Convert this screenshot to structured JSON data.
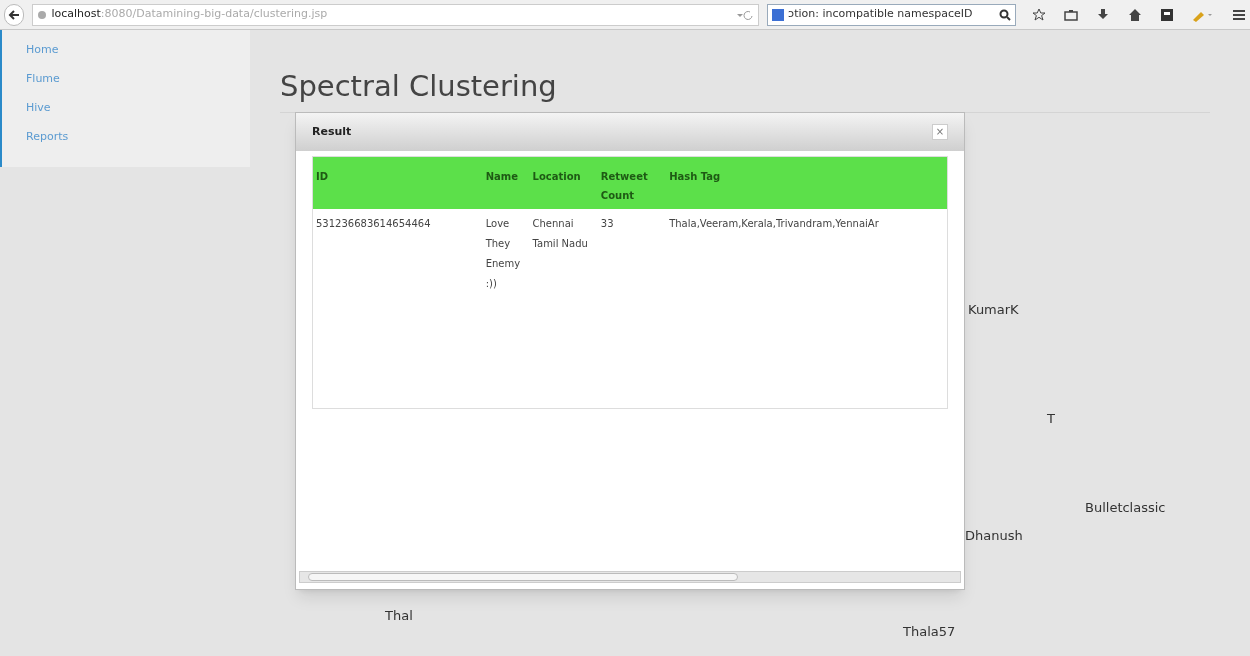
{
  "browser": {
    "url_host": "localhost",
    "url_path": ":8080/Datamining-big-data/clustering.jsp",
    "search_value": "ɔtion: incompatible namespaceID"
  },
  "sidebar": {
    "items": [
      {
        "label": "Home"
      },
      {
        "label": "Flume"
      },
      {
        "label": "Hive"
      },
      {
        "label": "Reports"
      }
    ]
  },
  "page": {
    "title": "Spectral Clustering"
  },
  "word_cloud": [
    {
      "text": "KumarK"
    },
    {
      "text": "T"
    },
    {
      "text": "Bulletclassic"
    },
    {
      "text": "Dhanush"
    },
    {
      "text": "Thal"
    },
    {
      "text": "Thala57"
    }
  ],
  "dialog": {
    "title": "Result",
    "close": "×",
    "table": {
      "columns": [
        "ID",
        "Name",
        "Location",
        "Retweet Count",
        "Hash Tag"
      ],
      "rows": [
        [
          "531236683614654464",
          "Love They Enemy :))",
          "Chennai Tamil Nadu",
          "33",
          "Thala,Veeram,Kerala,Trivandram,YennaiAr"
        ]
      ]
    }
  }
}
